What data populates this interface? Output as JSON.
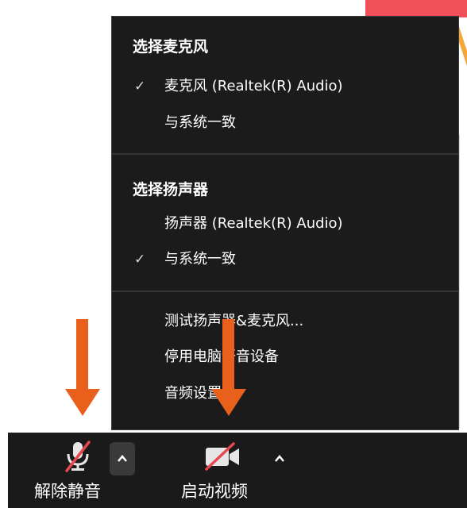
{
  "menu": {
    "mic_heading": "选择麦克风",
    "mic_items": [
      {
        "check": "✓",
        "label": "麦克风 (Realtek(R) Audio)"
      },
      {
        "check": "",
        "label": "与系统一致"
      }
    ],
    "speaker_heading": "选择扬声器",
    "speaker_items": [
      {
        "check": "",
        "label": "扬声器 (Realtek(R) Audio)"
      },
      {
        "check": "✓",
        "label": "与系统一致"
      }
    ],
    "actions": [
      {
        "label": "测试扬声器&麦克风..."
      },
      {
        "label": "停用电脑语音设备"
      },
      {
        "label": "音频设置..."
      }
    ]
  },
  "toolbar": {
    "unmute_label": "解除静音",
    "start_video_label": "启动视频"
  },
  "colors": {
    "menu_bg": "#1b1b1b",
    "toolbar_bg": "#1a1a1a",
    "muted_slash": "#e8474f",
    "annotation_arrow": "#e8601c"
  },
  "icons": {
    "check": "check-icon",
    "unmute": "microphone-muted-icon",
    "start_video": "video-camera-off-icon",
    "caret": "chevron-up-icon",
    "arrow": "arrow-down-annotation"
  }
}
